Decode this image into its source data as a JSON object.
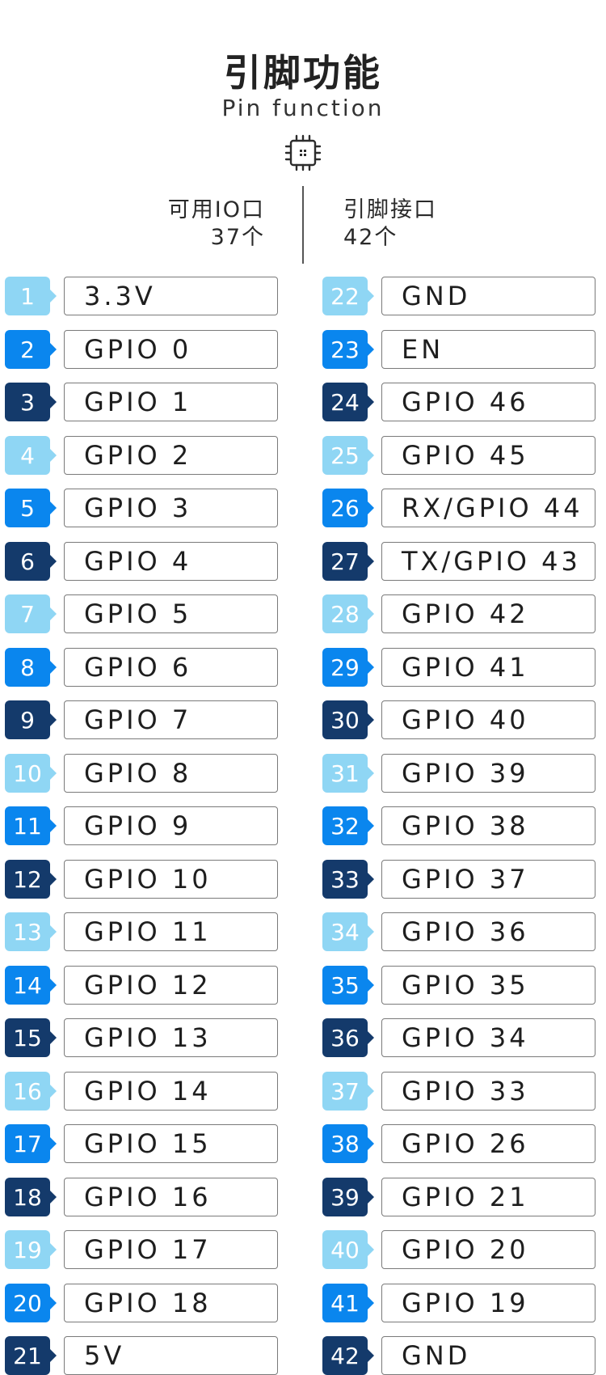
{
  "title": "引脚功能",
  "subtitle": "Pin function",
  "icon": "chip-icon",
  "stats": {
    "available_io_label": "可用IO口",
    "available_io_count": "37个",
    "pin_interface_label": "引脚接口",
    "pin_interface_count": "42个"
  },
  "colors": {
    "light": "#8fd6f4",
    "medium": "#0a86ee",
    "dark": "#143a6b"
  },
  "pins_left": [
    {
      "num": "1",
      "label": "3.3V"
    },
    {
      "num": "2",
      "label": "GPIO 0"
    },
    {
      "num": "3",
      "label": "GPIO 1"
    },
    {
      "num": "4",
      "label": "GPIO 2"
    },
    {
      "num": "5",
      "label": "GPIO 3"
    },
    {
      "num": "6",
      "label": "GPIO 4"
    },
    {
      "num": "7",
      "label": "GPIO 5"
    },
    {
      "num": "8",
      "label": "GPIO 6"
    },
    {
      "num": "9",
      "label": "GPIO 7"
    },
    {
      "num": "10",
      "label": "GPIO 8"
    },
    {
      "num": "11",
      "label": "GPIO 9"
    },
    {
      "num": "12",
      "label": "GPIO 10"
    },
    {
      "num": "13",
      "label": "GPIO 11"
    },
    {
      "num": "14",
      "label": "GPIO 12"
    },
    {
      "num": "15",
      "label": "GPIO 13"
    },
    {
      "num": "16",
      "label": "GPIO 14"
    },
    {
      "num": "17",
      "label": "GPIO 15"
    },
    {
      "num": "18",
      "label": "GPIO 16"
    },
    {
      "num": "19",
      "label": "GPIO 17"
    },
    {
      "num": "20",
      "label": "GPIO 18"
    },
    {
      "num": "21",
      "label": "5V"
    }
  ],
  "pins_right": [
    {
      "num": "22",
      "label": "GND"
    },
    {
      "num": "23",
      "label": "EN"
    },
    {
      "num": "24",
      "label": "GPIO 46"
    },
    {
      "num": "25",
      "label": "GPIO 45"
    },
    {
      "num": "26",
      "label": "RX/GPIO 44"
    },
    {
      "num": "27",
      "label": "TX/GPIO 43"
    },
    {
      "num": "28",
      "label": "GPIO 42"
    },
    {
      "num": "29",
      "label": "GPIO 41"
    },
    {
      "num": "30",
      "label": "GPIO 40"
    },
    {
      "num": "31",
      "label": "GPIO 39"
    },
    {
      "num": "32",
      "label": "GPIO 38"
    },
    {
      "num": "33",
      "label": "GPIO 37"
    },
    {
      "num": "34",
      "label": "GPIO 36"
    },
    {
      "num": "35",
      "label": "GPIO 35"
    },
    {
      "num": "36",
      "label": "GPIO 34"
    },
    {
      "num": "37",
      "label": "GPIO 33"
    },
    {
      "num": "38",
      "label": "GPIO 26"
    },
    {
      "num": "39",
      "label": "GPIO 21"
    },
    {
      "num": "40",
      "label": "GPIO 20"
    },
    {
      "num": "41",
      "label": "GPIO 19"
    },
    {
      "num": "42",
      "label": "GND"
    }
  ]
}
